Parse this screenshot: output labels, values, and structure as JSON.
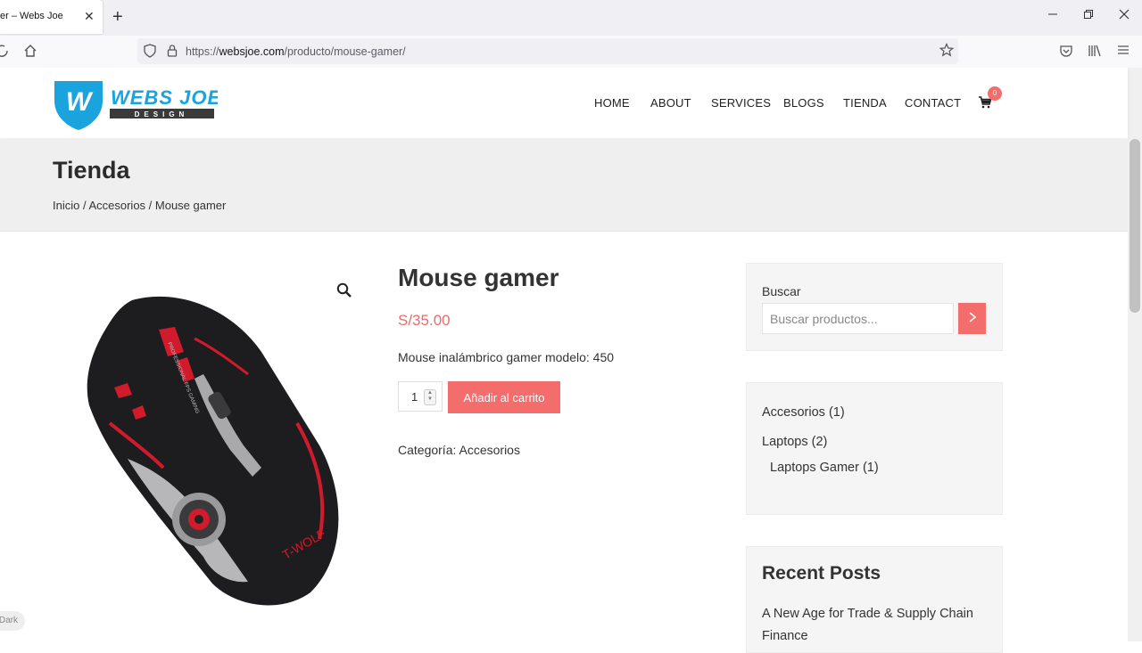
{
  "browser": {
    "tab_title": "er – Webs Joe",
    "tab_close": "✕",
    "new_tab": "+",
    "url_prefix": "https://",
    "url_domain": "websjoe.com",
    "url_path": "/producto/mouse-gamer/"
  },
  "logo": {
    "name": "WEBS JOE",
    "tagline": "DESIGN",
    "letter": "W"
  },
  "menu": [
    "HOME",
    "ABOUT",
    "SERVICES",
    "BLOGS",
    "TIENDA",
    "CONTACT"
  ],
  "cart": {
    "count": "0"
  },
  "page": {
    "title": "Tienda",
    "breadcrumb": "Inicio / Accesorios / Mouse gamer"
  },
  "product": {
    "title": "Mouse gamer",
    "price": "S/35.00",
    "description": "Mouse inalámbrico gamer modelo: 450",
    "quantity": "1",
    "add_to_cart": "Añadir al carrito",
    "category_label": "Categoría: ",
    "category": "Accesorios",
    "image_brand": "T-WOLF",
    "image_text": "PROFESSIONAL FPS GAMING"
  },
  "sidebar": {
    "search_label": "Buscar",
    "search_placeholder": "Buscar productos...",
    "categories": [
      "Accesorios (1)",
      "Laptops (2)",
      "Laptops Gamer (1)"
    ],
    "recent_title": "Recent Posts",
    "recent_posts": [
      "A New Age for Trade & Supply Chain Finance"
    ]
  },
  "dark_toggle": "Dark",
  "colors": {
    "accent": "#f36d6d",
    "logo_blue": "#1aa3dd",
    "logo_dark": "#3a3a3a"
  }
}
